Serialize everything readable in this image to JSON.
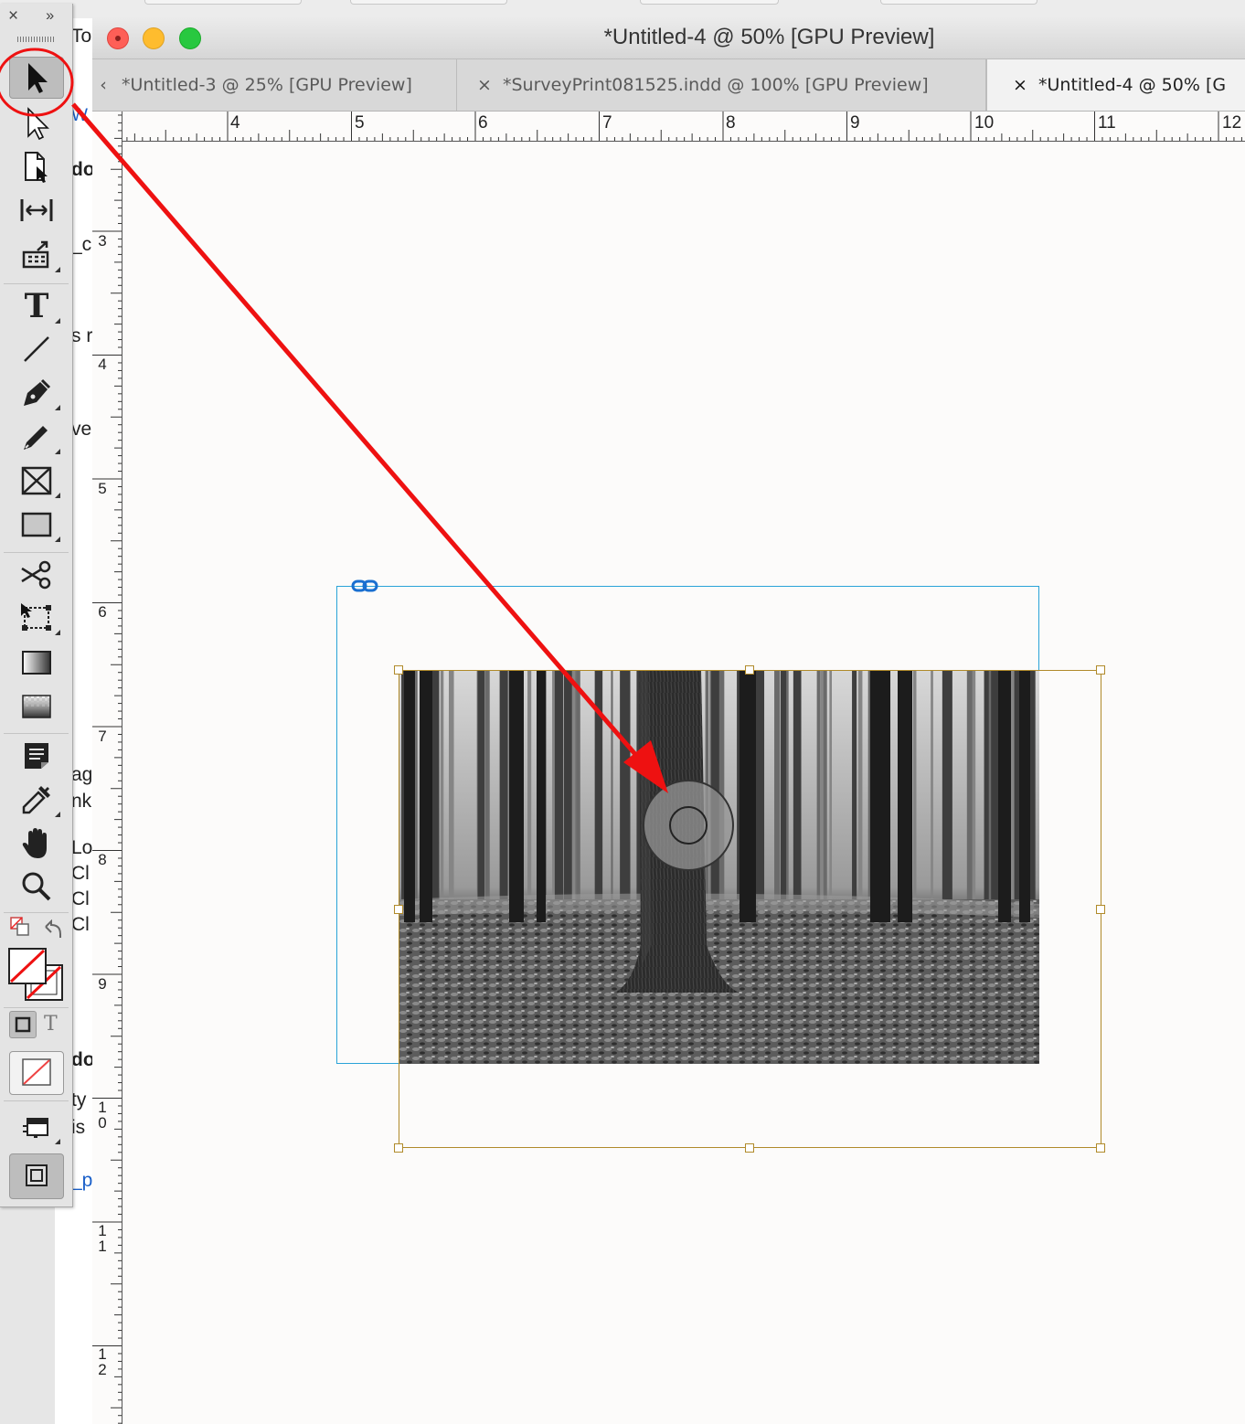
{
  "window": {
    "title": "*Untitled-4 @ 50% [GPU Preview]"
  },
  "tabs": [
    {
      "label": "*Untitled-3 @ 25% [GPU Preview]",
      "close": "‹"
    },
    {
      "label": "*SurveyPrint081525.indd @ 100% [GPU Preview]",
      "close": "×"
    },
    {
      "label": "*Untitled-4 @ 50% [G",
      "close": "×"
    }
  ],
  "toolbox": {
    "close": "×",
    "expand": "››",
    "header_fragment": "To"
  },
  "rulers": {
    "horizontal": [
      "4",
      "5",
      "6",
      "7",
      "8",
      "9",
      "10",
      "11",
      "12"
    ],
    "vertical": [
      {
        "top": "3",
        "bottom": ""
      },
      {
        "top": "4",
        "bottom": ""
      },
      {
        "top": "5",
        "bottom": ""
      },
      {
        "top": "6",
        "bottom": ""
      },
      {
        "top": "7",
        "bottom": ""
      },
      {
        "top": "8",
        "bottom": ""
      },
      {
        "top": "9",
        "bottom": ""
      },
      {
        "top": "1",
        "bottom": "0"
      },
      {
        "top": "1",
        "bottom": "1"
      },
      {
        "top": "1",
        "bottom": "2"
      }
    ]
  },
  "background_fragments": [
    "W",
    "do",
    "_c",
    "s r",
    "ve",
    "ag",
    "nk",
    "Lo",
    "Cl",
    "Cl",
    "Cl",
    "do",
    "ty",
    "is",
    "_p"
  ],
  "colors": {
    "annotation_red": "#ee1111",
    "text_frame": "#2aa3d8",
    "image_frame": "#b08a2a"
  }
}
